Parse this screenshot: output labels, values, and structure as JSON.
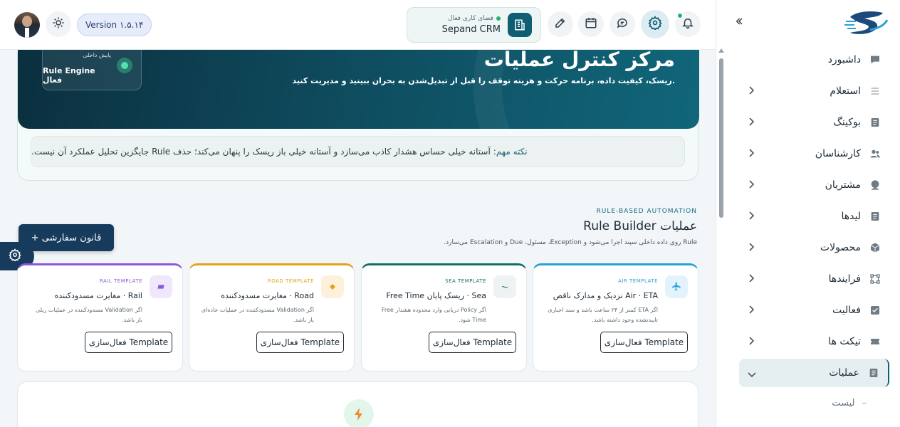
{
  "topbar": {
    "version": "Version ۱.۵.۱۴",
    "workspace_label": "فضای کاری فعال",
    "workspace_name": "Sepand CRM"
  },
  "sidebar": {
    "items": [
      {
        "label": "داشبورد",
        "icon": "chat-bubble-icon",
        "chevron": false
      },
      {
        "label": "استعلام",
        "icon": "list-icon",
        "chevron": true
      },
      {
        "label": "بوکینگ",
        "icon": "document-icon",
        "chevron": true
      },
      {
        "label": "کارشناسان",
        "icon": "users-icon",
        "chevron": true
      },
      {
        "label": "مشتریان",
        "icon": "user-icon",
        "chevron": true
      },
      {
        "label": "لیدها",
        "icon": "document-icon",
        "chevron": true
      },
      {
        "label": "محصولات",
        "icon": "box-icon",
        "chevron": true
      },
      {
        "label": "فرایندها",
        "icon": "process-icon",
        "chevron": true
      },
      {
        "label": "فعالیت",
        "icon": "check-square-icon",
        "chevron": true
      },
      {
        "label": "تیکت ها",
        "icon": "ticket-icon",
        "chevron": true
      },
      {
        "label": "عملیات",
        "icon": "document-icon",
        "chevron": true,
        "active": true
      }
    ],
    "sub_item": "لیست"
  },
  "hero": {
    "title": "مرکز کنترل عملیات",
    "subtitle": "ریسک، کیفیت داده، برنامه حرکت و هزینه توقف را قبل از تبدیل‌شدن به بحران ببینید و مدیریت کنید.",
    "pill_small": "پایش داخلی",
    "pill_main": "Rule Engine فعال",
    "note_label": "نکته مهم:",
    "note_text": "آستانه خیلی حساس هشدار کاذب می‌سازد و آستانه خیلی باز ریسک را پنهان می‌کند؛ حذف Rule جایگزین تحلیل عملکرد آن نیست."
  },
  "section": {
    "eyebrow": "RULE-BASED AUTOMATION",
    "title": "Rule Builder عملیات",
    "desc": "Rule روی داده داخلی سپند اجرا می‌شود و Exception، مسئول، Due و Escalation می‌سازد.",
    "custom_rule_button": "+ قانون سفارشی"
  },
  "cards": [
    {
      "tag": "AIR TEMPLATE",
      "title": "Air · ETA نزدیک و مدارک ناقص",
      "desc": "اگر ETA کمتر از ۲۴ ساعت باشد و سند اجباری تاییدنشده وجود داشته باشد.",
      "button": "فعال‌سازی Template",
      "color": "#2aa0d8",
      "icon": "plane-icon",
      "icon_bg": "#e3f3fb"
    },
    {
      "tag": "SEA TEMPLATE",
      "title": "Sea · ریسک پایان Free Time",
      "desc": "اگر Policy دریایی وارد محدوده هشدار Free Time شود.",
      "button": "فعال‌سازی Template",
      "color": "#137066",
      "icon": "ship-icon",
      "icon_bg": "#eef2f3"
    },
    {
      "tag": "ROAD TEMPLATE",
      "title": "Road · مغایرت مسدودکننده",
      "desc": "اگر Validation مسدودکننده در عملیات جاده‌ای باز باشد.",
      "button": "فعال‌سازی Template",
      "color": "#e3a21a",
      "icon": "diamond-icon",
      "icon_bg": "#fdf1dc"
    },
    {
      "tag": "RAIL TEMPLATE",
      "title": "Rail · مغایرت مسدودکننده",
      "desc": "اگر Validation مسدودکننده در عملیات ریلی باز باشد.",
      "button": "فعال‌سازی Template",
      "color": "#8a5ad8",
      "icon": "rail-icon",
      "icon_bg": "#efe7fb"
    }
  ]
}
